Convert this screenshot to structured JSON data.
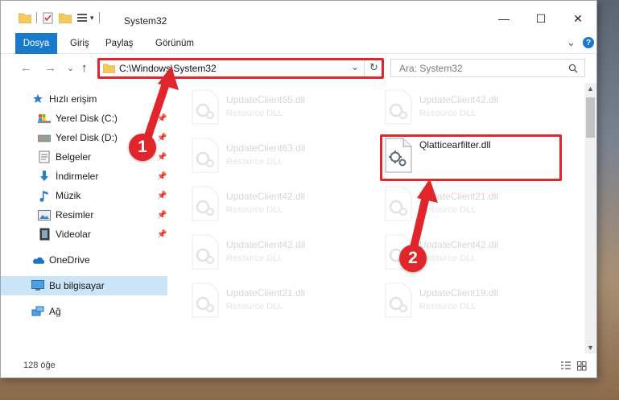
{
  "window": {
    "title": "System32",
    "controls": {
      "minimize": "—",
      "maximize": "☐",
      "close": "✕"
    }
  },
  "ribbon": {
    "tabs": [
      {
        "label": "Dosya",
        "active": true
      },
      {
        "label": "Giriş"
      },
      {
        "label": "Paylaş"
      },
      {
        "label": "Görünüm"
      }
    ],
    "expand": "⌄",
    "help": "?"
  },
  "address": {
    "path": "C:\\Windows\\System32",
    "search_placeholder": "Ara: System32",
    "refresh": "↻",
    "dropdown": "⌄"
  },
  "nav": {
    "back": "←",
    "forward": "→",
    "recent": "⌄",
    "up": "↑"
  },
  "sidebar": {
    "items": [
      {
        "label": "Hızlı erişim",
        "icon": "star-icon"
      },
      {
        "label": "Yerel Disk (C:)",
        "icon": "drive-icon",
        "pinned": true
      },
      {
        "label": "Yerel Disk (D:)",
        "icon": "drive-icon",
        "pinned": true
      },
      {
        "label": "Belgeler",
        "icon": "documents-icon",
        "pinned": true
      },
      {
        "label": "İndirmeler",
        "icon": "download-icon",
        "pinned": true
      },
      {
        "label": "Müzik",
        "icon": "music-icon",
        "pinned": true
      },
      {
        "label": "Resimler",
        "icon": "pictures-icon",
        "pinned": true
      },
      {
        "label": "Videolar",
        "icon": "videos-icon",
        "pinned": true
      },
      {
        "label": "OneDrive",
        "icon": "onedrive-icon"
      },
      {
        "label": "Bu bilgisayar",
        "icon": "computer-icon",
        "selected": true
      },
      {
        "label": "Ağ",
        "icon": "network-icon"
      }
    ]
  },
  "files": {
    "left": [
      {
        "name": "UpdateClient65.dll",
        "type": "Resource DLL"
      },
      {
        "name": "UpdateClient63.dll",
        "type": "Resource DLL"
      },
      {
        "name": "UpdateClient42.dll",
        "type": "Resource DLL"
      },
      {
        "name": "UpdateClient42.dll",
        "type": "Resource DLL"
      },
      {
        "name": "UpdateClient21.dll",
        "type": "Resource DLL"
      }
    ],
    "right": [
      {
        "name": "UpdateClient42.dll",
        "type": "Resource DLL"
      },
      {
        "name": "Qlatticearfilter.dll",
        "type": "",
        "highlighted": true
      },
      {
        "name": "UpdateClient21.dll",
        "type": "Resource DLL"
      },
      {
        "name": "UpdateClient42.dll",
        "type": "Resource DLL"
      },
      {
        "name": "UpdateClient19.dll",
        "type": "Resource DLL"
      }
    ]
  },
  "status": {
    "item_count": "128 öğe"
  },
  "annotations": {
    "step1": "1",
    "step2": "2"
  },
  "colors": {
    "accent": "#1979ca",
    "highlight": "#e0262b",
    "selected": "#cce4f7"
  }
}
